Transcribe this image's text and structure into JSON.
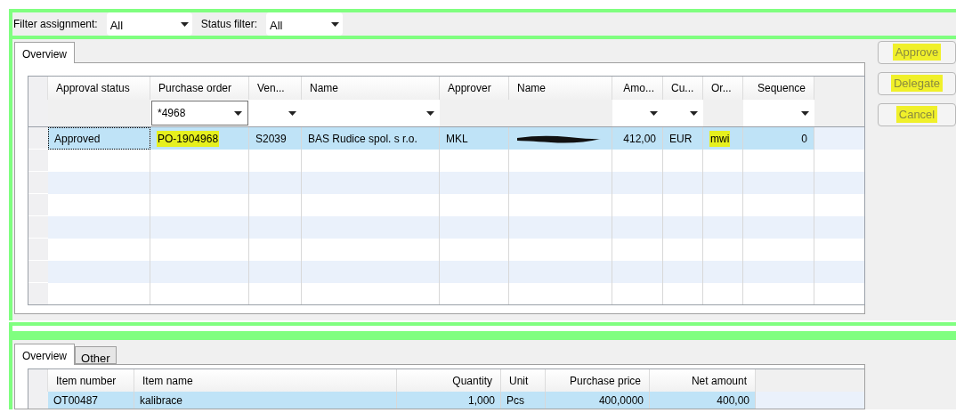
{
  "filters": [
    {
      "label": "Filter assignment:",
      "value": "All"
    },
    {
      "label": "Status filter:",
      "value": "All"
    }
  ],
  "top_tabs": [
    {
      "label": "Overview",
      "selected": true
    }
  ],
  "top_grid": {
    "columns": [
      {
        "label": "Approval status"
      },
      {
        "label": "Purchase order"
      },
      {
        "label": "Ven..."
      },
      {
        "label": "Name"
      },
      {
        "label": "Approver"
      },
      {
        "label": "Name"
      },
      {
        "label": "Amo..."
      },
      {
        "label": "Cu..."
      },
      {
        "label": "Or..."
      },
      {
        "label": "Sequence"
      }
    ],
    "filter_row": [
      {
        "kind": "blank"
      },
      {
        "kind": "field",
        "value": "*4968"
      },
      {
        "kind": "dropdown"
      },
      {
        "kind": "dropdown"
      },
      {
        "kind": "blank"
      },
      {
        "kind": "blank"
      },
      {
        "kind": "dropdown"
      },
      {
        "kind": "dropdown"
      },
      {
        "kind": "blank"
      },
      {
        "kind": "dropdown"
      }
    ],
    "rows": [
      {
        "selected": true,
        "cells": [
          {
            "kind": "text",
            "text": "Approved",
            "highlighted": false
          },
          {
            "kind": "text",
            "text": "PO-1904968",
            "highlighted": true
          },
          {
            "kind": "text",
            "text": "S2039",
            "highlighted": false
          },
          {
            "kind": "text",
            "text": "BAS Rudice spol. s r.o.",
            "highlighted": false
          },
          {
            "kind": "text",
            "text": "MKL",
            "highlighted": false
          },
          {
            "kind": "redacted"
          },
          {
            "kind": "text",
            "text": "412,00",
            "highlighted": false
          },
          {
            "kind": "text",
            "text": "EUR",
            "highlighted": false
          },
          {
            "kind": "text",
            "text": "mwi",
            "highlighted": true
          },
          {
            "kind": "text",
            "text": "0",
            "highlighted": false
          }
        ]
      }
    ]
  },
  "buttons": [
    {
      "label": "Approve",
      "highlighted": true
    },
    {
      "label": "Delegate",
      "highlighted": true
    },
    {
      "label": "Cancel",
      "highlighted": true
    }
  ],
  "bottom_tabs": [
    {
      "label": "Overview",
      "selected": true
    },
    {
      "label": "Other",
      "selected": false
    }
  ],
  "bottom_grid": {
    "columns": [
      {
        "label": "Item number"
      },
      {
        "label": "Item name"
      },
      {
        "label": "Quantity"
      },
      {
        "label": "Unit"
      },
      {
        "label": "Purchase price"
      },
      {
        "label": "Net amount"
      }
    ],
    "rows": [
      {
        "selected": true,
        "cells": [
          "OT00487",
          "kalibrace",
          "1,000",
          "Pcs",
          "400,0000",
          "400,00"
        ]
      }
    ]
  }
}
